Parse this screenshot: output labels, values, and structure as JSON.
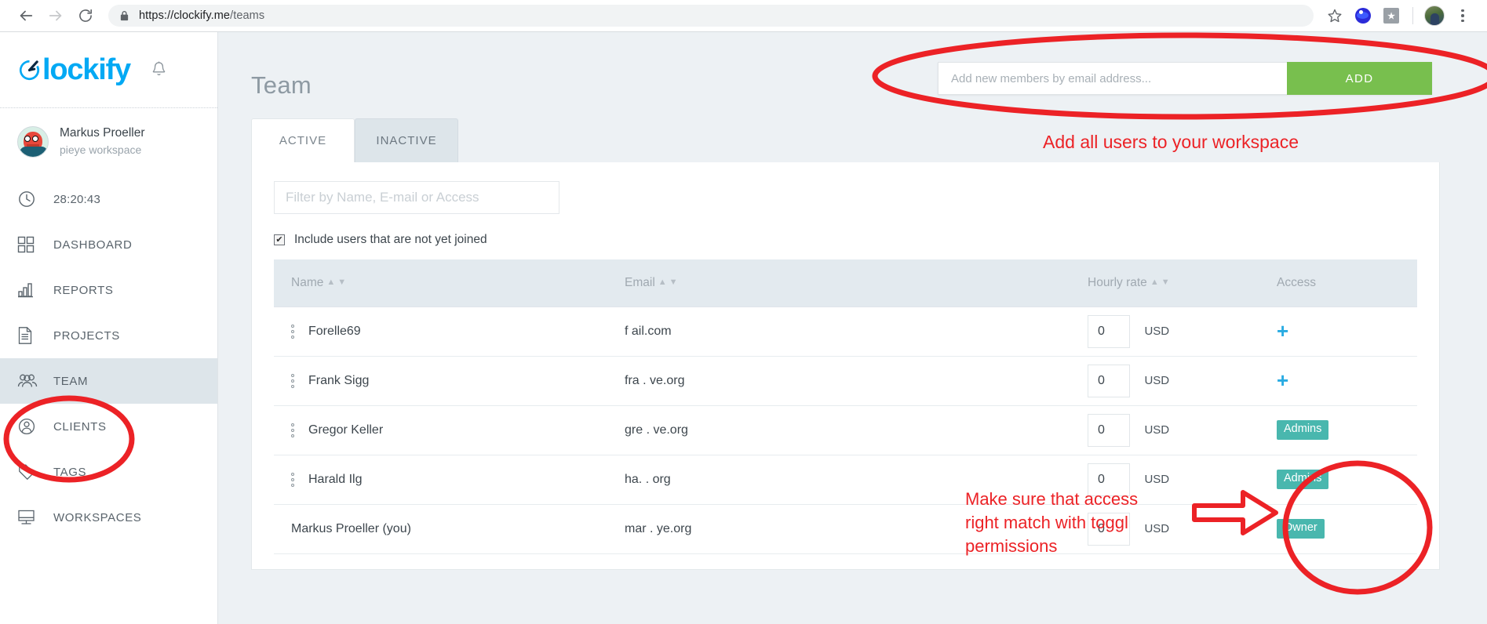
{
  "browser": {
    "back_label": "back-arrow",
    "forward_label": "forward-arrow",
    "reload_label": "reload",
    "url_secure": "https://clockify.me",
    "url_path": "/teams",
    "url_full": "https://clockify.me/teams",
    "icons": {
      "bookmark": "star-icon",
      "extension_blue": "extension-blue-icon",
      "extension_gray": "extension-gray-icon",
      "profile": "profile-avatar",
      "menu": "three-dot-menu-icon"
    }
  },
  "sidebar": {
    "brand": "lockify",
    "brand_prefix": "C",
    "notification_icon": "bell-icon",
    "user": {
      "name": "Markus Proeller",
      "workspace": "pieye workspace"
    },
    "items": [
      {
        "label": "28:20:43",
        "icon": "clock-icon",
        "active": false
      },
      {
        "label": "DASHBOARD",
        "icon": "grid-icon",
        "active": false
      },
      {
        "label": "REPORTS",
        "icon": "bar-chart-icon",
        "active": false
      },
      {
        "label": "PROJECTS",
        "icon": "document-icon",
        "active": false
      },
      {
        "label": "TEAM",
        "icon": "people-icon",
        "active": true
      },
      {
        "label": "CLIENTS",
        "icon": "person-circle-icon",
        "active": false
      },
      {
        "label": "TAGS",
        "icon": "tag-icon",
        "active": false
      },
      {
        "label": "WORKSPACES",
        "icon": "monitor-icon",
        "active": false
      }
    ]
  },
  "main": {
    "page_title": "Team",
    "add_members": {
      "placeholder": "Add new members by email address...",
      "value": "",
      "button_label": "ADD",
      "button_color": "#78bf4e"
    },
    "tabs": [
      {
        "label": "ACTIVE",
        "active": true
      },
      {
        "label": "INACTIVE",
        "active": false
      }
    ],
    "filter": {
      "placeholder": "Filter by Name, E-mail or Access",
      "value": ""
    },
    "include_checkbox": {
      "label": "Include users that are not yet joined",
      "checked": true,
      "mark": "✔"
    },
    "table": {
      "columns": [
        {
          "label": "Name",
          "sortable": true
        },
        {
          "label": "Email",
          "sortable": true
        },
        {
          "label": "Hourly rate",
          "sortable": true
        },
        {
          "label": "Access",
          "sortable": false
        }
      ],
      "currency": "USD",
      "rows": [
        {
          "name": "Forelle69",
          "email": "f                  ail.com",
          "rate": "0",
          "currency": "USD",
          "access_type": "add",
          "access_label": "+"
        },
        {
          "name": "Frank Sigg",
          "email": "fra       .      ve.org",
          "rate": "0",
          "currency": "USD",
          "access_type": "add",
          "access_label": "+"
        },
        {
          "name": "Gregor Keller",
          "email": "gre      .       ve.org",
          "rate": "0",
          "currency": "USD",
          "access_type": "badge",
          "access_label": "Admins"
        },
        {
          "name": "Harald Ilg",
          "email": "ha.     .        org",
          "rate": "0",
          "currency": "USD",
          "access_type": "badge",
          "access_label": "Admins"
        },
        {
          "name": "Markus Proeller (you)",
          "email": "mar     .       ye.org",
          "rate": "0",
          "currency": "USD",
          "access_type": "badge",
          "access_label": "Owner"
        }
      ]
    }
  },
  "annotations": {
    "color": "#ec2226",
    "add_users_note": "Add all users to your workspace",
    "access_note_line1": "Make sure that access",
    "access_note_line2": "right match with toggl",
    "access_note_line3": "permissions",
    "ellipse_add_box": "highlight-add-members",
    "ellipse_team_nav": "highlight-team-nav",
    "ellipse_access": "highlight-access-column",
    "arrow": "arrow-pointing-to-access"
  }
}
